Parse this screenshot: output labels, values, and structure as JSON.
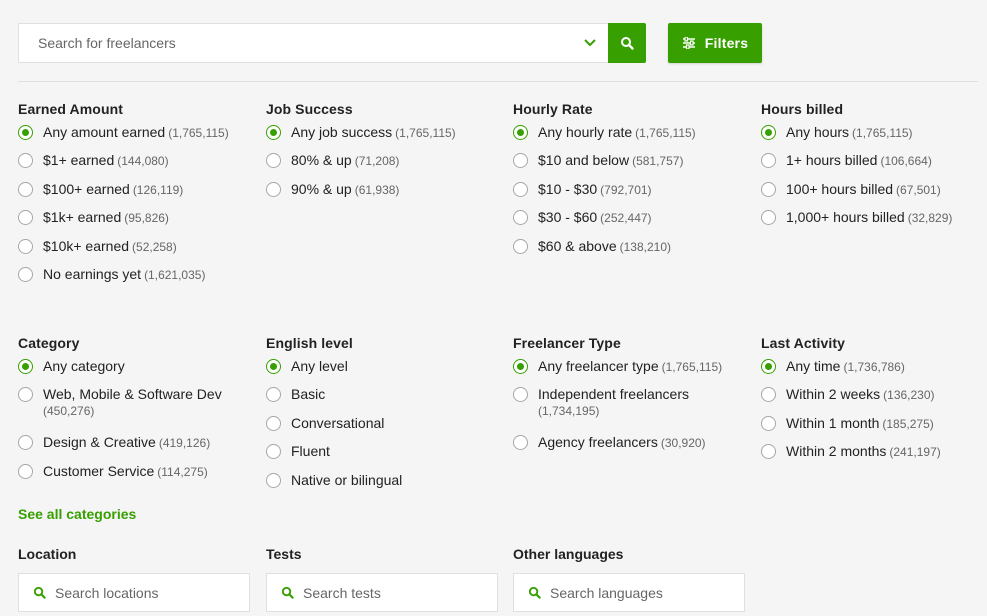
{
  "search": {
    "placeholder": "Search for freelancers"
  },
  "filters_button": {
    "label": "Filters"
  },
  "groups": {
    "earned": {
      "title": "Earned Amount",
      "options": [
        {
          "label": "Any amount earned",
          "count": "(1,765,115)",
          "selected": true
        },
        {
          "label": "$1+ earned",
          "count": "(144,080)"
        },
        {
          "label": "$100+ earned",
          "count": "(126,119)"
        },
        {
          "label": "$1k+ earned",
          "count": "(95,826)"
        },
        {
          "label": "$10k+ earned",
          "count": "(52,258)"
        },
        {
          "label": "No earnings yet",
          "count": "(1,621,035)"
        }
      ]
    },
    "job_success": {
      "title": "Job Success",
      "options": [
        {
          "label": "Any job success",
          "count": "(1,765,115)",
          "selected": true
        },
        {
          "label": "80% & up",
          "count": "(71,208)"
        },
        {
          "label": "90% & up",
          "count": "(61,938)"
        }
      ]
    },
    "hourly": {
      "title": "Hourly Rate",
      "options": [
        {
          "label": "Any hourly rate",
          "count": "(1,765,115)",
          "selected": true
        },
        {
          "label": "$10 and below",
          "count": "(581,757)"
        },
        {
          "label": "$10 - $30",
          "count": "(792,701)"
        },
        {
          "label": "$30 - $60",
          "count": "(252,447)"
        },
        {
          "label": "$60 & above",
          "count": "(138,210)"
        }
      ]
    },
    "hours": {
      "title": "Hours billed",
      "options": [
        {
          "label": "Any hours",
          "count": "(1,765,115)",
          "selected": true
        },
        {
          "label": "1+ hours billed",
          "count": "(106,664)"
        },
        {
          "label": "100+ hours billed",
          "count": "(67,501)"
        },
        {
          "label": "1,000+ hours billed",
          "count": "(32,829)"
        }
      ]
    },
    "category": {
      "title": "Category",
      "options": [
        {
          "label": "Any category",
          "count": "",
          "selected": true
        },
        {
          "label": "Web, Mobile & Software Dev",
          "count": "(450,276)"
        },
        {
          "label": "Design & Creative",
          "count": "(419,126)"
        },
        {
          "label": "Customer Service",
          "count": "(114,275)"
        }
      ],
      "see_all": "See all categories"
    },
    "english": {
      "title": "English level",
      "options": [
        {
          "label": "Any level",
          "count": "",
          "selected": true
        },
        {
          "label": "Basic",
          "count": ""
        },
        {
          "label": "Conversational",
          "count": ""
        },
        {
          "label": "Fluent",
          "count": ""
        },
        {
          "label": "Native or bilingual",
          "count": ""
        }
      ]
    },
    "type": {
      "title": "Freelancer Type",
      "options": [
        {
          "label": "Any freelancer type",
          "count": "(1,765,115)",
          "selected": true
        },
        {
          "label": "Independent freelancers",
          "count": "(1,734,195)"
        },
        {
          "label": "Agency freelancers",
          "count": "(30,920)"
        }
      ]
    },
    "activity": {
      "title": "Last Activity",
      "options": [
        {
          "label": "Any time",
          "count": "(1,736,786)",
          "selected": true
        },
        {
          "label": "Within 2 weeks",
          "count": "(136,230)"
        },
        {
          "label": "Within 1 month",
          "count": "(185,275)"
        },
        {
          "label": "Within 2 months",
          "count": "(241,197)"
        }
      ]
    }
  },
  "location": {
    "title": "Location",
    "placeholder": "Search locations"
  },
  "tests": {
    "title": "Tests",
    "placeholder": "Search tests"
  },
  "languages": {
    "title": "Other languages",
    "placeholder": "Search languages"
  },
  "colors": {
    "accent": "#37a000",
    "background": "#f5f5f5"
  }
}
